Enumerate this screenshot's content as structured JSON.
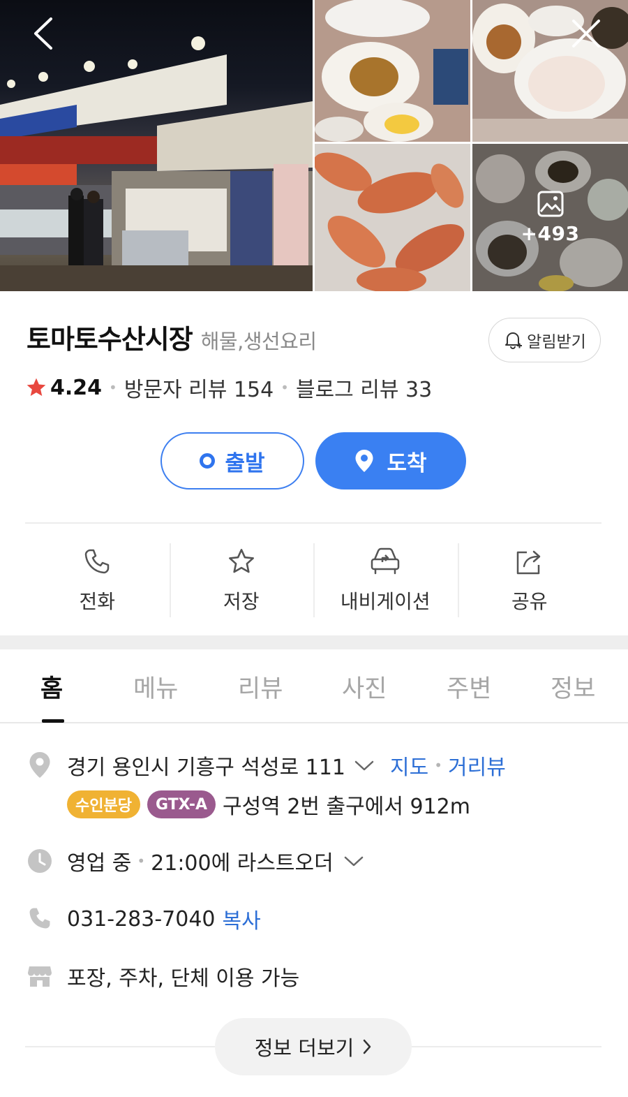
{
  "header": {
    "more_photos_count": "+493"
  },
  "place": {
    "name": "토마토수산시장",
    "category": "해물,생선요리",
    "alarm_label": "알림받기",
    "rating": "4.24",
    "visitor_review": "방문자 리뷰 154",
    "blog_review": "블로그 리뷰 33"
  },
  "route": {
    "start_label": "출발",
    "end_label": "도착"
  },
  "actions": [
    {
      "label": "전화",
      "icon": "phone-icon"
    },
    {
      "label": "저장",
      "icon": "star-icon"
    },
    {
      "label": "내비게이션",
      "icon": "car-navigation-icon"
    },
    {
      "label": "공유",
      "icon": "share-icon"
    }
  ],
  "tabs": [
    {
      "label": "홈",
      "active": true
    },
    {
      "label": "메뉴",
      "active": false
    },
    {
      "label": "리뷰",
      "active": false
    },
    {
      "label": "사진",
      "active": false
    },
    {
      "label": "주변",
      "active": false
    },
    {
      "label": "정보",
      "active": false
    }
  ],
  "info": {
    "address": "경기 용인시 기흥구 석성로 111",
    "map_link": "지도",
    "street_view_link": "거리뷰",
    "badge_line1": "수인분당",
    "badge_line1_color": "#f0b233",
    "badge_line2": "GTX-A",
    "badge_line2_color": "#9a5a8e",
    "station_text": "구성역 2번 출구에서 912m",
    "hours_status": "영업 중",
    "hours_text": "21:00에 라스트오더",
    "phone": "031-283-7040",
    "copy_label": "복사",
    "amenities": "포장, 주차, 단체 이용 가능",
    "more_label": "정보 더보기"
  },
  "colors": {
    "accent_blue": "#3a80f2",
    "star_red": "#e8483f",
    "link_blue": "#2d6fd6"
  }
}
